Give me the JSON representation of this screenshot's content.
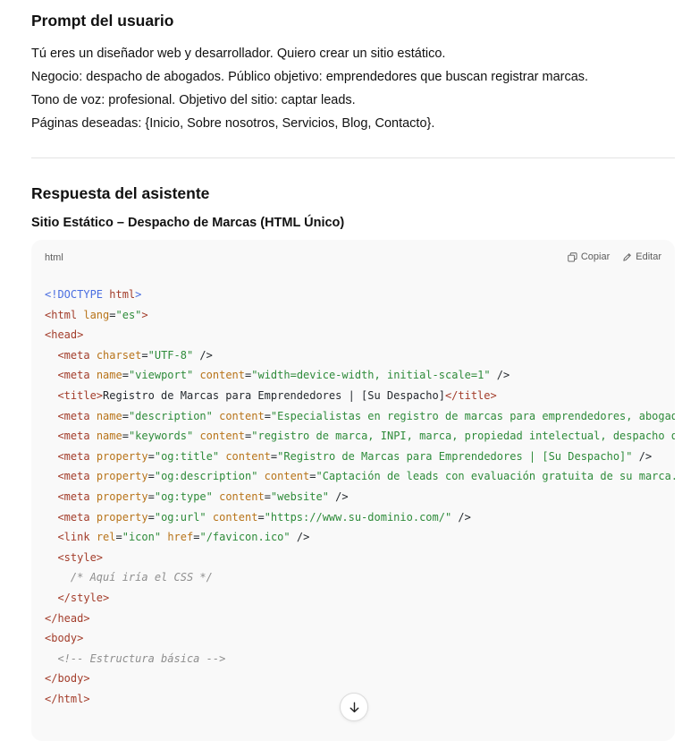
{
  "prompt": {
    "title": "Prompt del usuario",
    "lines": [
      "Tú eres un diseñador web y desarrollador. Quiero crear un sitio estático.",
      "Negocio: despacho de abogados. Público objetivo: emprendedores que buscan registrar marcas.",
      "Tono de voz: profesional. Objetivo del sitio: captar leads.",
      "Páginas deseadas: {Inicio, Sobre nosotros, Servicios, Blog, Contacto}."
    ]
  },
  "answer": {
    "title": "Respuesta del asistente",
    "subtitle": "Sitio Estático – Despacho de Marcas (HTML Único)"
  },
  "code_block": {
    "language": "html",
    "copy_label": "Copiar",
    "edit_label": "Editar",
    "lines": [
      [
        [
          "kw",
          "<!DOCTYPE "
        ],
        [
          "tag",
          "html"
        ],
        [
          "kw",
          ">"
        ]
      ],
      [
        [
          "tag",
          "<html "
        ],
        [
          "attr",
          "lang"
        ],
        [
          "pl",
          "="
        ],
        [
          "str",
          "\"es\""
        ],
        [
          "tag",
          ">"
        ]
      ],
      [
        [
          "tag",
          "<head>"
        ]
      ],
      [
        [
          "pl",
          "  "
        ],
        [
          "tag",
          "<meta "
        ],
        [
          "attr",
          "charset"
        ],
        [
          "pl",
          "="
        ],
        [
          "str",
          "\"UTF-8\""
        ],
        [
          "pl",
          " />"
        ]
      ],
      [
        [
          "pl",
          "  "
        ],
        [
          "tag",
          "<meta "
        ],
        [
          "attr",
          "name"
        ],
        [
          "pl",
          "="
        ],
        [
          "str",
          "\"viewport\""
        ],
        [
          "pl",
          " "
        ],
        [
          "attr",
          "content"
        ],
        [
          "pl",
          "="
        ],
        [
          "str",
          "\"width=device-width, initial-scale=1\""
        ],
        [
          "pl",
          " />"
        ]
      ],
      [
        [
          "pl",
          "  "
        ],
        [
          "tag",
          "<title>"
        ],
        [
          "pl",
          "Registro de Marcas para Emprendedores | [Su Despacho]"
        ],
        [
          "tag",
          "</title>"
        ]
      ],
      [
        [
          "pl",
          "  "
        ],
        [
          "tag",
          "<meta "
        ],
        [
          "attr",
          "name"
        ],
        [
          "pl",
          "="
        ],
        [
          "str",
          "\"description\""
        ],
        [
          "pl",
          " "
        ],
        [
          "attr",
          "content"
        ],
        [
          "pl",
          "="
        ],
        [
          "str",
          "\"Especialistas en registro de marcas para emprendedores, abogad"
        ]
      ],
      [
        [
          "pl",
          "  "
        ],
        [
          "tag",
          "<meta "
        ],
        [
          "attr",
          "name"
        ],
        [
          "pl",
          "="
        ],
        [
          "str",
          "\"keywords\""
        ],
        [
          "pl",
          " "
        ],
        [
          "attr",
          "content"
        ],
        [
          "pl",
          "="
        ],
        [
          "str",
          "\"registro de marca, INPI, marca, propiedad intelectual, despacho d"
        ]
      ],
      [
        [
          "pl",
          "  "
        ],
        [
          "tag",
          "<meta "
        ],
        [
          "attr",
          "property"
        ],
        [
          "pl",
          "="
        ],
        [
          "str",
          "\"og:title\""
        ],
        [
          "pl",
          " "
        ],
        [
          "attr",
          "content"
        ],
        [
          "pl",
          "="
        ],
        [
          "str",
          "\"Registro de Marcas para Emprendedores | [Su Despacho]\""
        ],
        [
          "pl",
          " />"
        ]
      ],
      [
        [
          "pl",
          "  "
        ],
        [
          "tag",
          "<meta "
        ],
        [
          "attr",
          "property"
        ],
        [
          "pl",
          "="
        ],
        [
          "str",
          "\"og:description\""
        ],
        [
          "pl",
          " "
        ],
        [
          "attr",
          "content"
        ],
        [
          "pl",
          "="
        ],
        [
          "str",
          "\"Captación de leads con evaluación gratuita de su marca."
        ]
      ],
      [
        [
          "pl",
          "  "
        ],
        [
          "tag",
          "<meta "
        ],
        [
          "attr",
          "property"
        ],
        [
          "pl",
          "="
        ],
        [
          "str",
          "\"og:type\""
        ],
        [
          "pl",
          " "
        ],
        [
          "attr",
          "content"
        ],
        [
          "pl",
          "="
        ],
        [
          "str",
          "\"website\""
        ],
        [
          "pl",
          " />"
        ]
      ],
      [
        [
          "pl",
          "  "
        ],
        [
          "tag",
          "<meta "
        ],
        [
          "attr",
          "property"
        ],
        [
          "pl",
          "="
        ],
        [
          "str",
          "\"og:url\""
        ],
        [
          "pl",
          " "
        ],
        [
          "attr",
          "content"
        ],
        [
          "pl",
          "="
        ],
        [
          "str",
          "\"https://www.su-dominio.com/\""
        ],
        [
          "pl",
          " />"
        ]
      ],
      [
        [
          "pl",
          "  "
        ],
        [
          "tag",
          "<link "
        ],
        [
          "attr",
          "rel"
        ],
        [
          "pl",
          "="
        ],
        [
          "str",
          "\"icon\""
        ],
        [
          "pl",
          " "
        ],
        [
          "attr",
          "href"
        ],
        [
          "pl",
          "="
        ],
        [
          "str",
          "\"/favicon.ico\""
        ],
        [
          "pl",
          " />"
        ]
      ],
      [
        [
          "pl",
          "  "
        ],
        [
          "tag",
          "<style>"
        ]
      ],
      [
        [
          "pl",
          "    "
        ],
        [
          "com",
          "/* Aquí iría el CSS */"
        ]
      ],
      [
        [
          "pl",
          "  "
        ],
        [
          "tag",
          "</style>"
        ]
      ],
      [
        [
          "tag",
          "</head>"
        ]
      ],
      [
        [
          "tag",
          "<body>"
        ]
      ],
      [
        [
          "pl",
          "  "
        ],
        [
          "com",
          "<!-- Estructura básica -->"
        ]
      ],
      [
        [
          "tag",
          "</body>"
        ]
      ],
      [
        [
          "tag",
          "</html>"
        ]
      ]
    ]
  },
  "icons": {
    "copy": "copy-icon",
    "edit": "pencil-icon",
    "scroll": "arrow-down-icon"
  }
}
